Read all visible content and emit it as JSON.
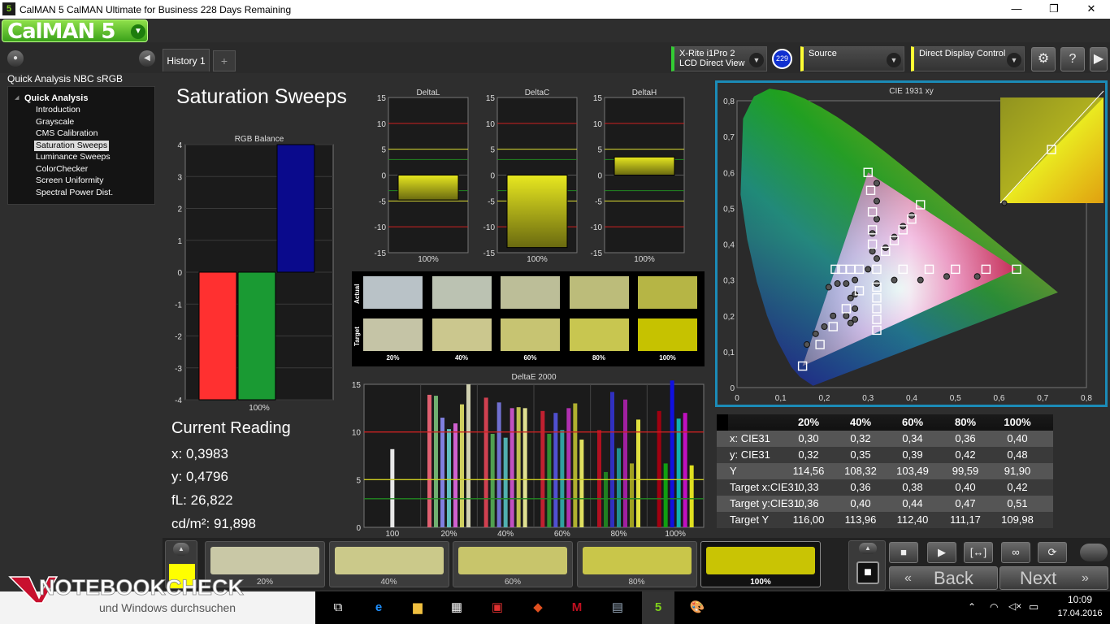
{
  "window": {
    "title": "CalMAN 5 CalMAN Ultimate for Business 228 Days Remaining",
    "app_icon": "5",
    "minimize": "—",
    "restore": "❐",
    "close": "✕"
  },
  "logo": {
    "text": "CalMAN 5"
  },
  "tabs": {
    "history": "History 1",
    "add": "+"
  },
  "devices": {
    "meter": {
      "line1": "X-Rite i1Pro 2",
      "line2": "LCD Direct View",
      "badge": "229",
      "accent": "#33cc33"
    },
    "source": {
      "label": "Source",
      "accent": "#ffff33"
    },
    "display": {
      "label": "Direct Display Control",
      "accent": "#ffff33"
    }
  },
  "toolbar_icons": [
    "gear-icon",
    "help-icon",
    "collapse-icon"
  ],
  "sidebar": {
    "workflow_title": "Quick Analysis NBC sRGB",
    "section": "Quick Analysis",
    "items": [
      "Introduction",
      "Grayscale",
      "CMS Calibration",
      "Saturation Sweeps",
      "Luminance Sweeps",
      "ColorChecker",
      "Screen Uniformity",
      "Spectral Power Dist."
    ],
    "selected_index": 3
  },
  "page": {
    "title": "Saturation Sweeps"
  },
  "chart_data": [
    {
      "type": "bar",
      "title": "RGB Balance",
      "categories": [
        "100%"
      ],
      "series": [
        {
          "name": "R",
          "values": [
            -4.0
          ],
          "color": "#ff3030"
        },
        {
          "name": "G",
          "values": [
            -4.0
          ],
          "color": "#1a9a33"
        },
        {
          "name": "B",
          "values": [
            4.0
          ],
          "color": "#0a0a8c"
        }
      ],
      "ylim": [
        -4,
        4
      ],
      "yticks": [
        "4",
        "3",
        "2",
        "1",
        "0",
        "-1",
        "-2",
        "-3",
        "-4"
      ]
    },
    {
      "type": "bar",
      "title": "DeltaL",
      "categories": [
        "100%"
      ],
      "values": [
        -4.8
      ],
      "ylim": [
        -15,
        15
      ],
      "yticks": [
        "15",
        "10",
        "5",
        "0",
        "-5",
        "-10",
        "-15"
      ]
    },
    {
      "type": "bar",
      "title": "DeltaC",
      "categories": [
        "100%"
      ],
      "values": [
        -14.0
      ],
      "ylim": [
        -15,
        15
      ],
      "yticks": [
        "15",
        "10",
        "5",
        "0",
        "-5",
        "-10",
        "-15"
      ]
    },
    {
      "type": "bar",
      "title": "DeltaH",
      "categories": [
        "100%"
      ],
      "values": [
        3.5
      ],
      "ylim": [
        -15,
        15
      ],
      "yticks": [
        "15",
        "10",
        "5",
        "0",
        "-5",
        "-10",
        "-15"
      ]
    },
    {
      "type": "bar",
      "title": "DeltaE 2000",
      "ylim": [
        0,
        15
      ],
      "yticks": [
        "15",
        "10",
        "5",
        "0"
      ],
      "xticks": [
        "100",
        "20%",
        "40%",
        "60%",
        "80%",
        "100%"
      ],
      "groups": [
        {
          "label": "100",
          "values": [
            8.2
          ],
          "colors": [
            "#e8e8e8"
          ]
        },
        {
          "label": "20%",
          "values": [
            13.9,
            13.8,
            11.5,
            10.3,
            10.9,
            12.9,
            15.0
          ],
          "colors": [
            "#e06070",
            "#70b070",
            "#8080e0",
            "#60c0c0",
            "#d060d0",
            "#d0d060",
            "#d0d0b0"
          ]
        },
        {
          "label": "40%",
          "values": [
            13.6,
            9.8,
            13.1,
            9.4,
            12.5,
            12.6,
            12.5
          ],
          "colors": [
            "#d04050",
            "#50a050",
            "#7070d0",
            "#50b0b0",
            "#c050c0",
            "#c0c050",
            "#e0e090"
          ]
        },
        {
          "label": "60%",
          "values": [
            12.2,
            9.8,
            12.0,
            10.2,
            12.5,
            13.0,
            9.2
          ],
          "colors": [
            "#c02030",
            "#309030",
            "#5050d0",
            "#30a0a0",
            "#b030b0",
            "#b0b030",
            "#e0e060"
          ]
        },
        {
          "label": "80%",
          "values": [
            10.2,
            5.8,
            14.2,
            8.3,
            13.4,
            6.7,
            11.3
          ],
          "colors": [
            "#b01020",
            "#208020",
            "#3030c0",
            "#209090",
            "#a020a0",
            "#a0a020",
            "#e0e040"
          ]
        },
        {
          "label": "100%",
          "values": [
            12.2,
            6.7,
            15.4,
            11.4,
            12.0,
            6.5
          ],
          "colors": [
            "#a00010",
            "#10a010",
            "#1010e0",
            "#10b0b0",
            "#c010c0",
            "#e0e020"
          ]
        }
      ],
      "reference_lines": [
        {
          "value": 10,
          "color": "#cc2222"
        },
        {
          "value": 5,
          "color": "#cccc22"
        },
        {
          "value": 3,
          "color": "#228822"
        }
      ]
    },
    {
      "type": "scatter",
      "title": "CIE 1931 xy",
      "xlim": [
        0,
        0.8
      ],
      "ylim": [
        0,
        0.8
      ],
      "xticks": [
        "0",
        "0,1",
        "0,2",
        "0,3",
        "0,4",
        "0,5",
        "0,6",
        "0,7",
        "0,8"
      ],
      "yticks": [
        "0",
        "0,1",
        "0,2",
        "0,3",
        "0,4",
        "0,5",
        "0,6",
        "0,7",
        "0,8"
      ],
      "gamut": {
        "red": [
          0.64,
          0.33
        ],
        "green": [
          0.3,
          0.6
        ],
        "blue": [
          0.15,
          0.06
        ],
        "white": [
          0.3127,
          0.329
        ]
      },
      "targets": [
        [
          0.64,
          0.33
        ],
        [
          0.57,
          0.33
        ],
        [
          0.5,
          0.33
        ],
        [
          0.44,
          0.33
        ],
        [
          0.38,
          0.33
        ],
        [
          0.3,
          0.6
        ],
        [
          0.306,
          0.55
        ],
        [
          0.31,
          0.49
        ],
        [
          0.31,
          0.44
        ],
        [
          0.31,
          0.4
        ],
        [
          0.15,
          0.06
        ],
        [
          0.19,
          0.12
        ],
        [
          0.22,
          0.17
        ],
        [
          0.25,
          0.22
        ],
        [
          0.28,
          0.27
        ],
        [
          0.42,
          0.51
        ],
        [
          0.4,
          0.47
        ],
        [
          0.38,
          0.44
        ],
        [
          0.36,
          0.41
        ],
        [
          0.34,
          0.38
        ],
        [
          0.225,
          0.33
        ],
        [
          0.24,
          0.33
        ],
        [
          0.26,
          0.33
        ],
        [
          0.28,
          0.33
        ],
        [
          0.32,
          0.33
        ],
        [
          0.32,
          0.28
        ],
        [
          0.32,
          0.25
        ],
        [
          0.32,
          0.22
        ],
        [
          0.32,
          0.19
        ],
        [
          0.32,
          0.16
        ]
      ],
      "measured": [
        [
          0.55,
          0.31
        ],
        [
          0.48,
          0.31
        ],
        [
          0.42,
          0.3
        ],
        [
          0.36,
          0.3
        ],
        [
          0.32,
          0.29
        ],
        [
          0.32,
          0.57
        ],
        [
          0.32,
          0.52
        ],
        [
          0.32,
          0.47
        ],
        [
          0.31,
          0.43
        ],
        [
          0.31,
          0.38
        ],
        [
          0.16,
          0.12
        ],
        [
          0.18,
          0.15
        ],
        [
          0.2,
          0.17
        ],
        [
          0.22,
          0.2
        ],
        [
          0.26,
          0.25
        ],
        [
          0.4,
          0.48
        ],
        [
          0.38,
          0.45
        ],
        [
          0.36,
          0.42
        ],
        [
          0.34,
          0.39
        ],
        [
          0.32,
          0.36
        ],
        [
          0.21,
          0.28
        ],
        [
          0.23,
          0.29
        ],
        [
          0.25,
          0.29
        ],
        [
          0.27,
          0.3
        ],
        [
          0.3,
          0.33
        ],
        [
          0.27,
          0.26
        ],
        [
          0.27,
          0.22
        ],
        [
          0.27,
          0.19
        ],
        [
          0.26,
          0.18
        ],
        [
          0.25,
          0.2
        ]
      ]
    }
  ],
  "swatches": {
    "row_labels": [
      "Actual",
      "Target"
    ],
    "labels": [
      "20%",
      "40%",
      "60%",
      "80%",
      "100%"
    ],
    "actual": [
      "#b9c2c7",
      "#bbc2b2",
      "#bcbe98",
      "#bcbc7a",
      "#b6b545"
    ],
    "target": [
      "#c5c4a6",
      "#cbc78e",
      "#c7c472",
      "#c8c650",
      "#c6c200"
    ]
  },
  "current_reading": {
    "title": "Current Reading",
    "x": "x: 0,3983",
    "y": "y: 0,4796",
    "fl": "fL: 26,822",
    "cdm2": "cd/m²: 91,898"
  },
  "table": {
    "headers": [
      "20%",
      "40%",
      "60%",
      "80%",
      "100%"
    ],
    "rows": [
      {
        "label": "x: CIE31",
        "cells": [
          "0,30",
          "0,32",
          "0,34",
          "0,36",
          "0,40"
        ]
      },
      {
        "label": "y: CIE31",
        "cells": [
          "0,32",
          "0,35",
          "0,39",
          "0,42",
          "0,48"
        ]
      },
      {
        "label": "Y",
        "cells": [
          "114,56",
          "108,32",
          "103,49",
          "99,59",
          "91,90"
        ]
      },
      {
        "label": "Target x:CIE31",
        "cells": [
          "0,33",
          "0,36",
          "0,38",
          "0,40",
          "0,42"
        ]
      },
      {
        "label": "Target y:CIE31",
        "cells": [
          "0,36",
          "0,40",
          "0,44",
          "0,47",
          "0,51"
        ]
      },
      {
        "label": "Target Y",
        "cells": [
          "116,00",
          "113,96",
          "112,40",
          "111,17",
          "109,98"
        ]
      }
    ]
  },
  "bottom_swatches": {
    "current_color": "#ffff00",
    "items": [
      {
        "label": "20%",
        "color": "#c9c8a6"
      },
      {
        "label": "40%",
        "color": "#cbc98a"
      },
      {
        "label": "60%",
        "color": "#c8c56b"
      },
      {
        "label": "80%",
        "color": "#c9c64a"
      },
      {
        "label": "100%",
        "color": "#c9c404"
      }
    ],
    "selected_index": 4
  },
  "controls": {
    "back": "Back",
    "next": "Next",
    "stop": "■",
    "play": "▶",
    "fit": "[↔]",
    "loop": "∞",
    "refresh": "⟳"
  },
  "taskbar": {
    "search_placeholder": "und Windows durchsuchen",
    "watermark": "NOTEBOOKCHECK",
    "time": "10:09",
    "date": "17.04.2016"
  }
}
